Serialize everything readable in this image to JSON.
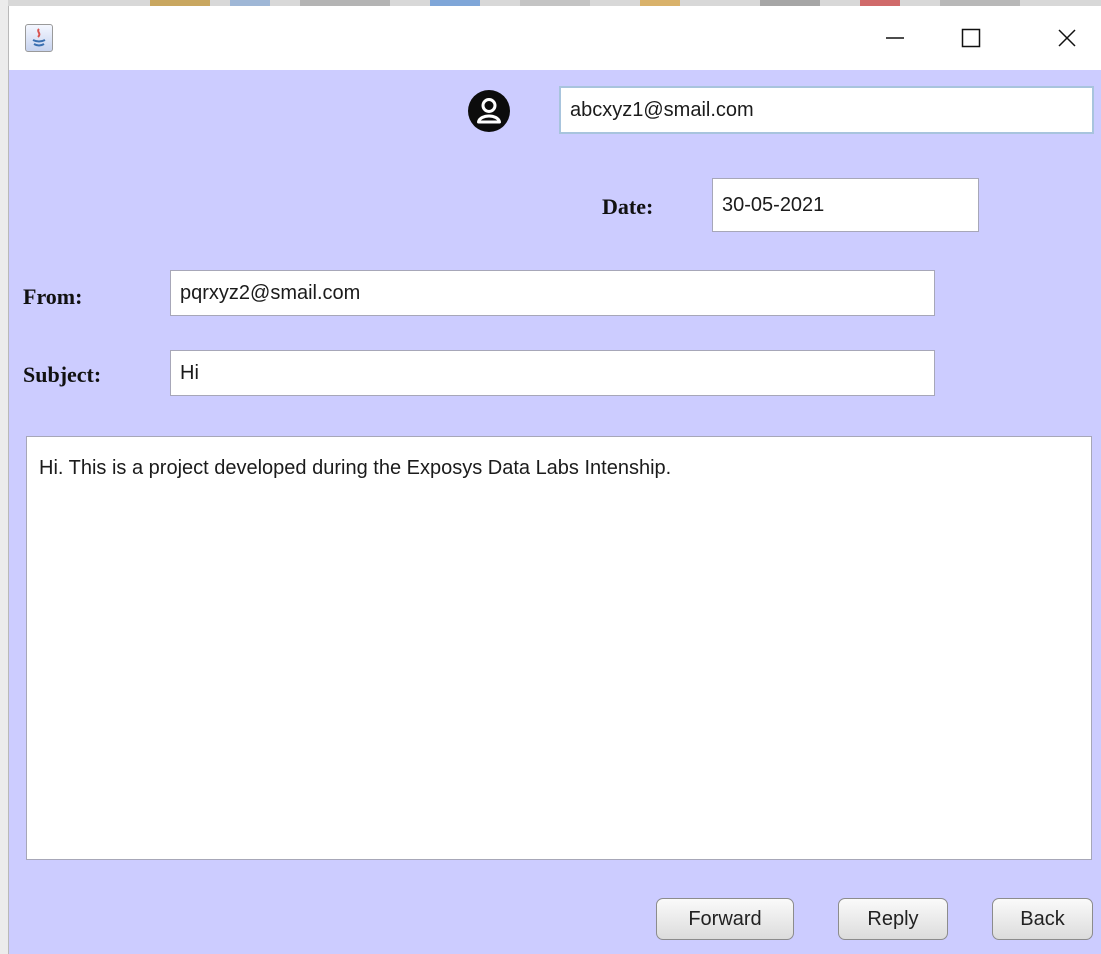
{
  "window": {
    "app_icon": "java-app-icon",
    "controls": {
      "minimize_icon": "minimize-icon",
      "maximize_icon": "maximize-icon",
      "close_icon": "close-icon"
    }
  },
  "header": {
    "avatar_icon": "user-avatar-icon",
    "user_email": "abcxyz1@smail.com"
  },
  "date": {
    "label": "Date:",
    "value": "30-05-2021"
  },
  "from": {
    "label": "From:",
    "value": "pqrxyz2@smail.com"
  },
  "subject": {
    "label": "Subject:",
    "value": "Hi"
  },
  "message": {
    "body": "Hi. This is a project developed during the Exposys Data Labs Intenship."
  },
  "buttons": {
    "forward": "Forward",
    "reply": "Reply",
    "back": "Back"
  },
  "colors": {
    "panel_background": "#ccccff",
    "field_background": "#ffffff",
    "focus_border": "#a8c4dd"
  }
}
